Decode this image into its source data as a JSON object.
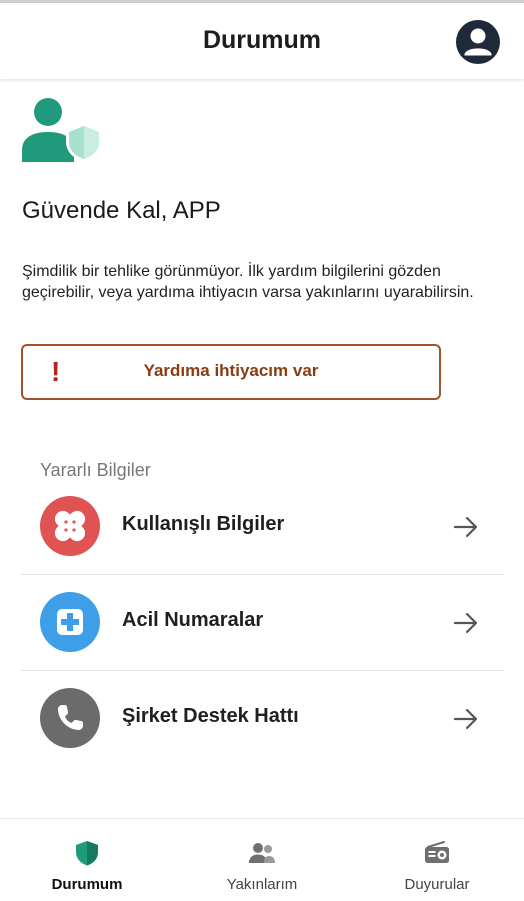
{
  "header": {
    "title": "Durumum"
  },
  "hero": {
    "greeting": "Güvende Kal, APP",
    "status": "Şimdilik bir tehlike görünmüyor. İlk yardım bilgilerini gözden geçirebilir, veya yardıma ihtiyacın varsa yakınlarını uyarabilirsin."
  },
  "help_button": {
    "mark": "!",
    "label": "Yardıma ihtiyacım var"
  },
  "section": {
    "title": "Yararlı Bilgiler"
  },
  "items": [
    {
      "label": "Kullanışlı Bilgiler",
      "icon": "bandage-icon",
      "color": "#e05353"
    },
    {
      "label": "Acil Numaralar",
      "icon": "medical-plus-icon",
      "color": "#3f9ee8"
    },
    {
      "label": "Şirket Destek Hattı",
      "icon": "phone-icon",
      "color": "#6b6b6b"
    }
  ],
  "nav": [
    {
      "label": "Durumum",
      "icon": "shield-icon",
      "active": true
    },
    {
      "label": "Yakınlarım",
      "icon": "people-icon",
      "active": false
    },
    {
      "label": "Duyurular",
      "icon": "radio-icon",
      "active": false
    }
  ],
  "colors": {
    "primary": "#1f9a7a",
    "primary_light": "#a7e0cd",
    "danger_border": "#a0522d",
    "danger_text": "#8a3d10",
    "danger_mark": "#b3261e",
    "dark_icon": "#1e2a3a"
  }
}
